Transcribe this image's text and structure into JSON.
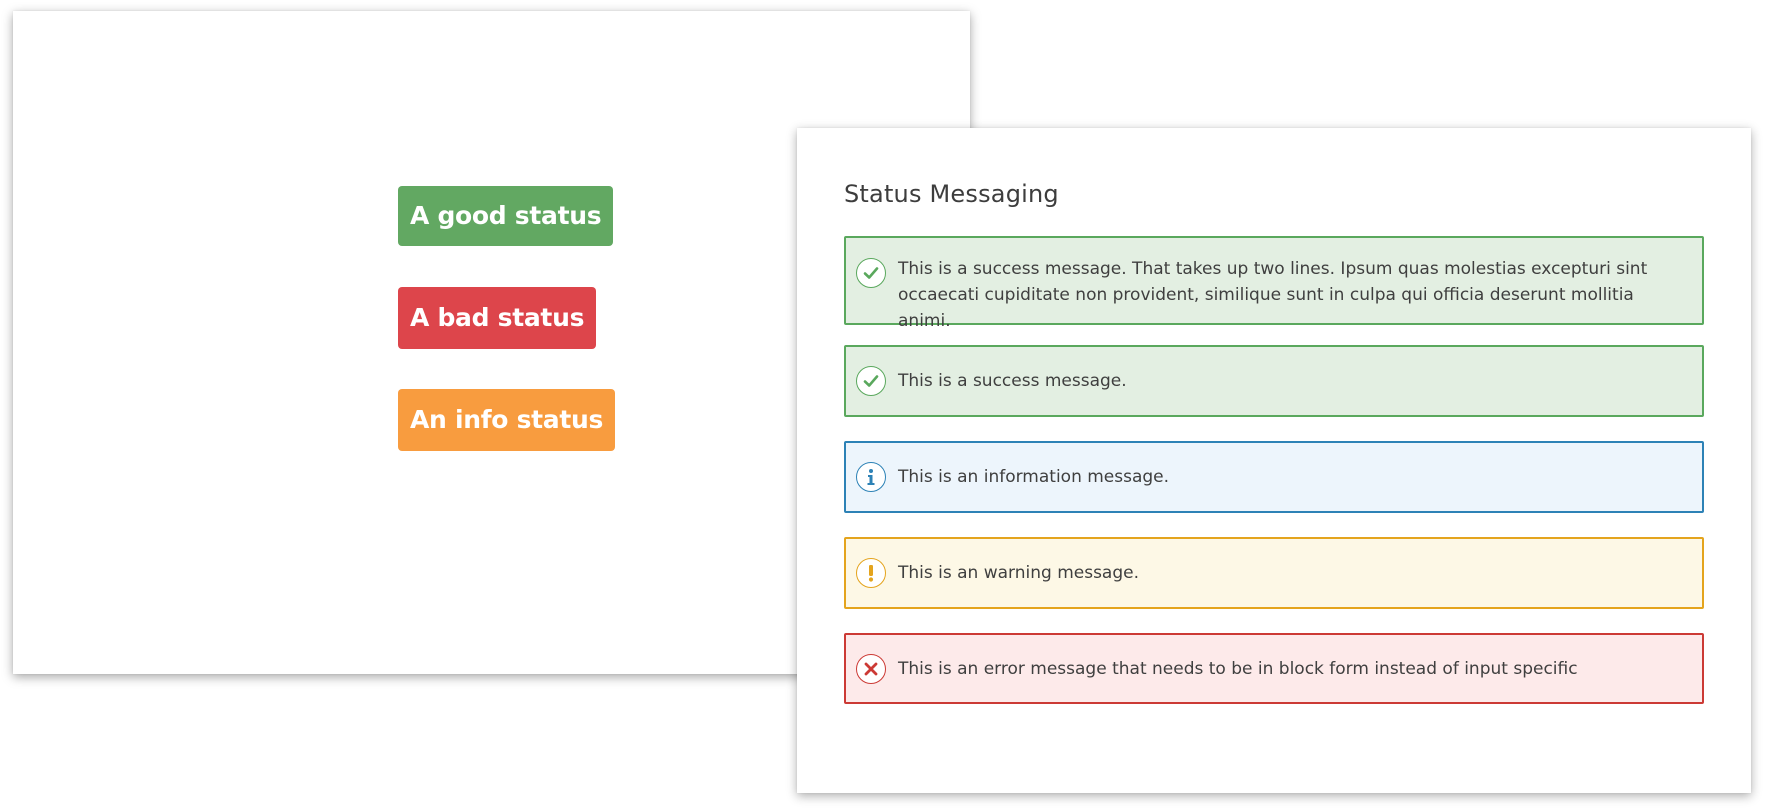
{
  "badges": [
    {
      "label": "A good status",
      "color": "#62a862"
    },
    {
      "label": "A bad status",
      "color": "#dd454b"
    },
    {
      "label": "An info status",
      "color": "#f89c3f"
    }
  ],
  "panel": {
    "title": "Status Messaging",
    "messages": [
      {
        "type": "success",
        "icon": "check-icon",
        "text": "This is a success message. That takes up two lines. Ipsum quas molestias excepturi sint occaecati cupiditate non provident, similique sunt in culpa qui officia deserunt mollitia animi."
      },
      {
        "type": "success",
        "icon": "check-icon",
        "text": "This is a success message."
      },
      {
        "type": "info",
        "icon": "info-icon",
        "text": "This is an information message."
      },
      {
        "type": "warning",
        "icon": "exclamation-icon",
        "text": "This is an warning message."
      },
      {
        "type": "error",
        "icon": "close-icon",
        "text": "This is an error message that needs to be in block form instead of input specific"
      }
    ]
  },
  "colors": {
    "success_border": "#5aa85d",
    "success_bg": "#e3efe2",
    "info_border": "#2d82b6",
    "info_bg": "#edf5fc",
    "warning_border": "#e4a41d",
    "warning_bg": "#fdf8e6",
    "error_border": "#cc3a35",
    "error_bg": "#fdeaea"
  }
}
